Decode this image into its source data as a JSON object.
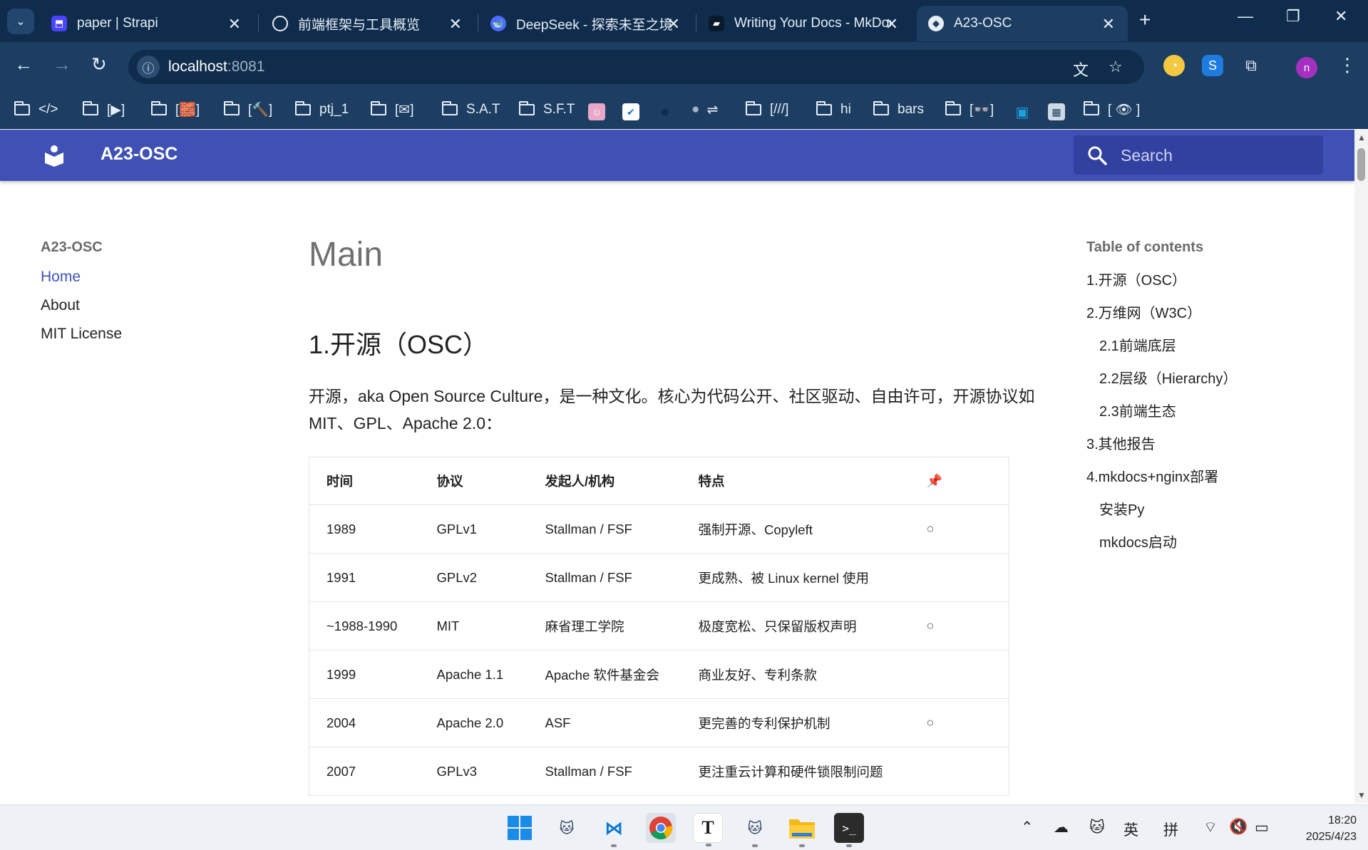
{
  "browser": {
    "tabs": [
      {
        "title": "paper | Strapi",
        "icon": "strapi-icon",
        "color": "#4945ff"
      },
      {
        "title": "前端框架与工具概览",
        "icon": "chatgpt-icon",
        "color": "#1d3e63"
      },
      {
        "title": "DeepSeek - 探索未至之境",
        "icon": "deepseek-icon",
        "color": "#4d6bfe"
      },
      {
        "title": "Writing Your Docs - MkDocs",
        "icon": "mkdocs-icon",
        "color": "#0f2c4c"
      },
      {
        "title": "A23-OSC",
        "icon": "material-icon",
        "color": "#3a3a3a"
      }
    ],
    "url_host": "localhost",
    "url_port": ":8081",
    "bookmarks": [
      {
        "label": "</>",
        "type": "folder"
      },
      {
        "label": "[▶]",
        "type": "folder"
      },
      {
        "label": "[🧱]",
        "type": "folder"
      },
      {
        "label": "[🔨]",
        "type": "folder"
      },
      {
        "label": "ptj_1",
        "type": "folder"
      },
      {
        "label": "[✉]",
        "type": "folder"
      },
      {
        "label": "S.A.T",
        "type": "folder"
      },
      {
        "label": "S.F.T",
        "type": "folder"
      },
      {
        "label": "⇌",
        "type": "folder-apple"
      },
      {
        "label": "[///]",
        "type": "folder"
      },
      {
        "label": "hi",
        "type": "folder"
      },
      {
        "label": "bars",
        "type": "folder"
      },
      {
        "label": "[👓]",
        "type": "folder"
      },
      {
        "label": "[ 👁 ]",
        "type": "folder"
      }
    ],
    "profile_initial": "n"
  },
  "site": {
    "title": "A23-OSC",
    "search_placeholder": "Search",
    "brand_color": "#4051b5"
  },
  "nav": {
    "title": "A23-OSC",
    "items": [
      "Home",
      "About",
      "MIT License"
    ]
  },
  "main": {
    "h1": "Main",
    "h2": "1.开源（OSC）",
    "paragraph": "开源，aka Open Source Culture，是一种文化。核心为代码公开、社区驱动、自由许可，开源协议如MIT、GPL、Apache 2.0：",
    "table": {
      "headers": [
        "时间",
        "协议",
        "发起人/机构",
        "特点",
        "📌"
      ],
      "rows": [
        [
          "1989",
          "GPLv1",
          "Stallman / FSF",
          "强制开源、Copyleft",
          "○"
        ],
        [
          "1991",
          "GPLv2",
          "Stallman / FSF",
          "更成熟、被 Linux kernel 使用",
          ""
        ],
        [
          "~1988-1990",
          "MIT",
          "麻省理工学院",
          "极度宽松、只保留版权声明",
          "○"
        ],
        [
          "1999",
          "Apache 1.1",
          "Apache 软件基金会",
          "商业友好、专利条款",
          ""
        ],
        [
          "2004",
          "Apache 2.0",
          "ASF",
          "更完善的专利保护机制",
          "○"
        ],
        [
          "2007",
          "GPLv3",
          "Stallman / FSF",
          "更注重云计算和硬件锁限制问题",
          ""
        ]
      ]
    }
  },
  "toc": {
    "title": "Table of contents",
    "items": [
      {
        "label": "1.开源（OSC）",
        "level": 1
      },
      {
        "label": "2.万维网（W3C）",
        "level": 1
      },
      {
        "label": "2.1前端底层",
        "level": 2
      },
      {
        "label": "2.2层级（Hierarchy）",
        "level": 2
      },
      {
        "label": "2.3前端生态",
        "level": 2
      },
      {
        "label": "3.其他报告",
        "level": 1
      },
      {
        "label": "4.mkdocs+nginx部署",
        "level": 1
      },
      {
        "label": "安装Py",
        "level": 2
      },
      {
        "label": "mkdocs启动",
        "level": 2
      }
    ]
  },
  "taskbar": {
    "ime_lang": "英",
    "ime_mode": "拼",
    "time": "18:20",
    "date": "2025/4/23"
  }
}
